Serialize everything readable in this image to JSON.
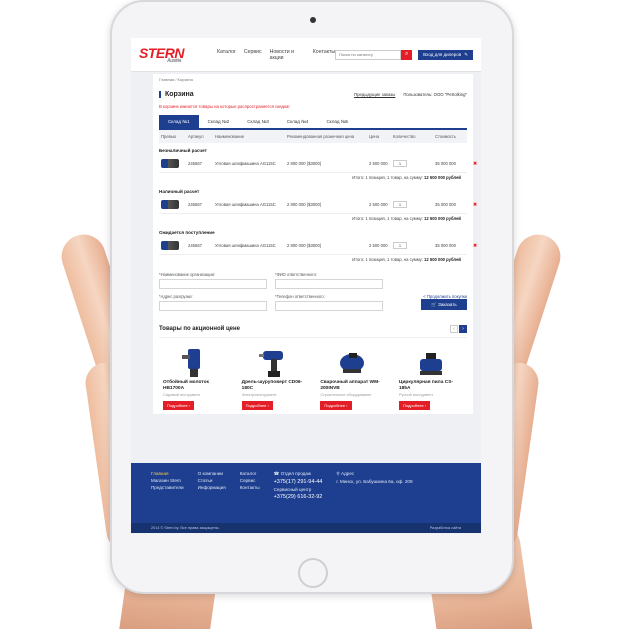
{
  "header": {
    "logo": "STERN",
    "logo_sub": "Austria",
    "nav": [
      "Каталог",
      "Сервис",
      "Новости и акции",
      "Контакты"
    ],
    "search_placeholder": "Поиск по каталогу",
    "dealer_button": "Вход для дилеров"
  },
  "breadcrumb": "Главная / Корзина",
  "page": {
    "title": "Корзина",
    "prev_orders": "Предыдущие заказы",
    "user": "Пользователь: ООО \"Petrolking\"",
    "warning": "В корзине имеются товары на которые распространяется скидка!"
  },
  "tabs": [
    "Склад №1",
    "Склад №2",
    "Склад №3",
    "Склад №4",
    "Склад №5"
  ],
  "table": {
    "headers": [
      "Превью",
      "Артикул",
      "Наименование",
      "Рекомендованная розничная цена",
      "Цена",
      "Количество",
      "Стоимость"
    ],
    "groups": [
      {
        "title": "Безналичный расчет",
        "row": {
          "article": "245567",
          "name": "Угловая шлифмашина AG115C",
          "rrp": "2 800 000 ($3000)",
          "price": "2 500 000",
          "qty": "1",
          "cost": "35 000 000"
        },
        "total_label": "Итого: 1 позиция, 1 товар, на сумму:",
        "total_value": "12 500 000 рублей"
      },
      {
        "title": "Наличный расчет",
        "row": {
          "article": "245567",
          "name": "Угловая шлифмашина AG115C",
          "rrp": "2 800 000 ($3000)",
          "price": "2 500 000",
          "qty": "1",
          "cost": "35 000 000"
        },
        "total_label": "Итого: 1 позиция, 1 товар, на сумму:",
        "total_value": "12 500 000 рублей"
      },
      {
        "title": "Ожидается поступление",
        "row": {
          "article": "245567",
          "name": "Угловая шлифмашина AG115C",
          "rrp": "2 800 000 ($3000)",
          "price": "2 500 000",
          "qty": "1",
          "cost": "35 000 000"
        },
        "total_label": "Итого: 1 позиция, 1 товар, на сумму:",
        "total_value": "12 500 000 рублей"
      }
    ]
  },
  "form": {
    "org_label": "Наименование организации:",
    "fio_label": "ФИО ответственного:",
    "address_label": "Адрес разгрузки:",
    "phone_label": "Телефон ответственного:",
    "continue_link": "< Продолжить покупки",
    "order_button": "Заказать"
  },
  "promo": {
    "title": "Товары по акционной цене",
    "more": "Подробнее",
    "products": [
      {
        "name": "Отбойный молоток HB1700A",
        "cat": "Садовый инструмент"
      },
      {
        "name": "Дрель-шуруповерт CD06-180C",
        "cat": "Электроинструмент"
      },
      {
        "name": "Сварочный аппарат WM-200INVB",
        "cat": "Строительное оборудование"
      },
      {
        "name": "Циркулярная пила CS-185A",
        "cat": "Ручной инструмент"
      }
    ]
  },
  "footer": {
    "col1": [
      "Главная",
      "Магазин Stern",
      "Представители"
    ],
    "col2": [
      "О компании",
      "Статьи",
      "Информация"
    ],
    "col3": [
      "Каталог",
      "Сервис",
      "Контакты"
    ],
    "sales_label": "Отдел продаж",
    "sales_phone": "+375(17) 291-94-44",
    "service_label": "Сервисный центр",
    "service_phone": "+375(29) 616-32-92",
    "address_label": "Адрес",
    "address": "г. Минск, ул. Бабушкина 6а, оф. 209",
    "copyright": "2014 © Stern.by. Все права защищены.",
    "dev": "Разработка сайта"
  }
}
